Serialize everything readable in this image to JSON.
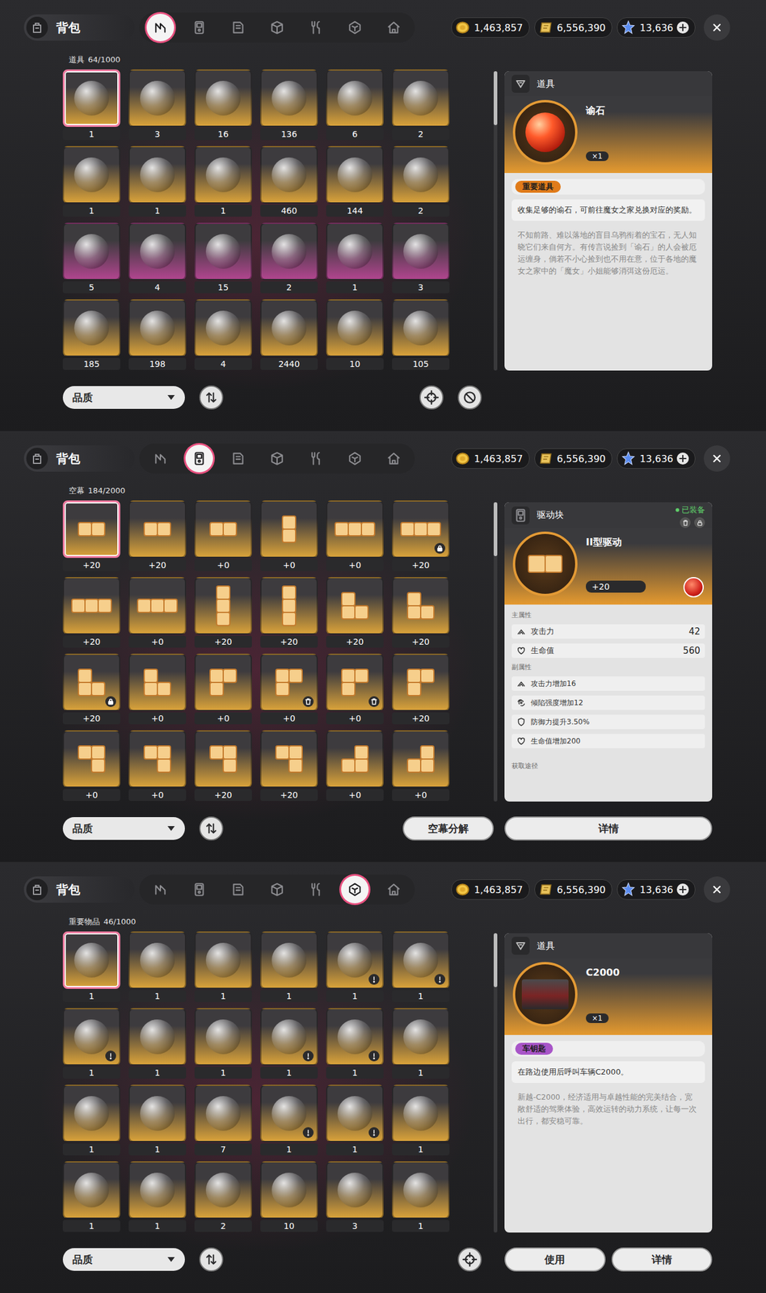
{
  "panels": [
    {
      "title": "背包",
      "tabs": [
        {
          "kind": "items",
          "selected": true
        },
        {
          "kind": "drive",
          "selected": false
        },
        {
          "kind": "book",
          "selected": false
        },
        {
          "kind": "box",
          "selected": false
        },
        {
          "kind": "food",
          "selected": false
        },
        {
          "kind": "important",
          "selected": false
        },
        {
          "kind": "home",
          "selected": false
        }
      ],
      "currencies": [
        {
          "kind": "coin",
          "amount": "1,463,857",
          "addable": false
        },
        {
          "kind": "ticket",
          "amount": "6,556,390",
          "addable": false
        },
        {
          "kind": "crystal",
          "amount": "13,636",
          "addable": true
        }
      ],
      "grid": {
        "label": "道具",
        "capacity": "64/1000",
        "items": [
          {
            "kind": "item",
            "count": "1",
            "color": "#d9a23a",
            "selected": true,
            "badge": "none"
          },
          {
            "kind": "item",
            "count": "3",
            "color": "#d9a23a",
            "selected": false,
            "badge": "none"
          },
          {
            "kind": "item",
            "count": "16",
            "color": "#d9a23a",
            "selected": false,
            "badge": "none"
          },
          {
            "kind": "item",
            "count": "136",
            "color": "#d9a23a",
            "selected": false,
            "badge": "none"
          },
          {
            "kind": "item",
            "count": "6",
            "color": "#d9a23a",
            "selected": false,
            "badge": "none"
          },
          {
            "kind": "item",
            "count": "2",
            "color": "#d9a23a",
            "selected": false,
            "badge": "none"
          },
          {
            "kind": "item",
            "count": "1",
            "color": "#d9a23a",
            "selected": false,
            "badge": "none"
          },
          {
            "kind": "item",
            "count": "1",
            "color": "#d9a23a",
            "selected": false,
            "badge": "none"
          },
          {
            "kind": "item",
            "count": "1",
            "color": "#d9a23a",
            "selected": false,
            "badge": "none"
          },
          {
            "kind": "item",
            "count": "460",
            "color": "#d9a23a",
            "selected": false,
            "badge": "none"
          },
          {
            "kind": "item",
            "count": "144",
            "color": "#d9a23a",
            "selected": false,
            "badge": "none"
          },
          {
            "kind": "item",
            "count": "2",
            "color": "#d9a23a",
            "selected": false,
            "badge": "none"
          },
          {
            "kind": "item",
            "count": "5",
            "color": "#b0458e",
            "selected": false,
            "badge": "none"
          },
          {
            "kind": "item",
            "count": "4",
            "color": "#b0458e",
            "selected": false,
            "badge": "none"
          },
          {
            "kind": "item",
            "count": "15",
            "color": "#b0458e",
            "selected": false,
            "badge": "none"
          },
          {
            "kind": "item",
            "count": "2",
            "color": "#b0458e",
            "selected": false,
            "badge": "none"
          },
          {
            "kind": "item",
            "count": "1",
            "color": "#b0458e",
            "selected": false,
            "badge": "none"
          },
          {
            "kind": "item",
            "count": "3",
            "color": "#b0458e",
            "selected": false,
            "badge": "none"
          },
          {
            "kind": "item",
            "count": "185",
            "color": "#d9a23a",
            "selected": false,
            "badge": "none"
          },
          {
            "kind": "item",
            "count": "198",
            "color": "#d9a23a",
            "selected": false,
            "badge": "none"
          },
          {
            "kind": "item",
            "count": "4",
            "color": "#d9a23a",
            "selected": false,
            "badge": "none"
          },
          {
            "kind": "item",
            "count": "2440",
            "color": "#d9a23a",
            "selected": false,
            "badge": "none"
          },
          {
            "kind": "item",
            "count": "10",
            "color": "#d9a23a",
            "selected": false,
            "badge": "none"
          },
          {
            "kind": "item",
            "count": "105",
            "color": "#d9a23a",
            "selected": false,
            "badge": "none"
          }
        ]
      },
      "filter": {
        "label": "品质"
      },
      "tools": [
        "locate",
        "ban"
      ],
      "left_actions": [],
      "detail": {
        "kind": "gem",
        "category": "道具",
        "name": "谕石",
        "qty": "×1",
        "tag": {
          "text": "重要道具",
          "color": "#e07b1a"
        },
        "desc": "收集足够的谕石，可前往魔女之家兑换对应的奖励。",
        "lore": "不知前路、难以落地的盲目乌鸦衔着的宝石，无人知晓它们来自何方。有传言说捡到「谕石」的人会被厄运缠身，倘若不小心捡到也不用在意，位于各地的魔女之家中的「魔女」小姐能够消弭这份厄运。"
      },
      "detail_actions": []
    },
    {
      "title": "背包",
      "tabs": [
        {
          "kind": "items",
          "selected": false
        },
        {
          "kind": "drive",
          "selected": true
        },
        {
          "kind": "book",
          "selected": false
        },
        {
          "kind": "box",
          "selected": false
        },
        {
          "kind": "food",
          "selected": false
        },
        {
          "kind": "important",
          "selected": false
        },
        {
          "kind": "home",
          "selected": false
        }
      ],
      "currencies": [
        {
          "kind": "coin",
          "amount": "1,463,857",
          "addable": false
        },
        {
          "kind": "ticket",
          "amount": "6,556,390",
          "addable": false
        },
        {
          "kind": "crystal",
          "amount": "13,636",
          "addable": true
        }
      ],
      "grid": {
        "label": "空幕",
        "capacity": "184/2000",
        "items": [
          {
            "kind": "h2",
            "count": "+20",
            "color": "#d9a23a",
            "selected": true,
            "badge": "none"
          },
          {
            "kind": "h2",
            "count": "+20",
            "color": "#d9a23a",
            "selected": false,
            "badge": "none"
          },
          {
            "kind": "h2",
            "count": "+0",
            "color": "#d9a23a",
            "selected": false,
            "badge": "none"
          },
          {
            "kind": "v2",
            "count": "+0",
            "color": "#d9a23a",
            "selected": false,
            "badge": "none"
          },
          {
            "kind": "h3",
            "count": "+0",
            "color": "#d9a23a",
            "selected": false,
            "badge": "none"
          },
          {
            "kind": "h3",
            "count": "+20",
            "color": "#d9a23a",
            "selected": false,
            "badge": "lock"
          },
          {
            "kind": "h3",
            "count": "+20",
            "color": "#d9a23a",
            "selected": false,
            "badge": "none"
          },
          {
            "kind": "h3",
            "count": "+0",
            "color": "#d9a23a",
            "selected": false,
            "badge": "none"
          },
          {
            "kind": "v3",
            "count": "+20",
            "color": "#d9a23a",
            "selected": false,
            "badge": "none"
          },
          {
            "kind": "v3",
            "count": "+20",
            "color": "#d9a23a",
            "selected": false,
            "badge": "none"
          },
          {
            "kind": "ell",
            "count": "+20",
            "color": "#d9a23a",
            "selected": false,
            "badge": "none"
          },
          {
            "kind": "ell",
            "count": "+20",
            "color": "#d9a23a",
            "selected": false,
            "badge": "none"
          },
          {
            "kind": "ell",
            "count": "+20",
            "color": "#d9a23a",
            "selected": false,
            "badge": "lock"
          },
          {
            "kind": "ell",
            "count": "+0",
            "color": "#d9a23a",
            "selected": false,
            "badge": "none"
          },
          {
            "kind": "gamma",
            "count": "+0",
            "color": "#d9a23a",
            "selected": false,
            "badge": "none"
          },
          {
            "kind": "gamma",
            "count": "+0",
            "color": "#d9a23a",
            "selected": false,
            "badge": "trash"
          },
          {
            "kind": "gamma",
            "count": "+0",
            "color": "#d9a23a",
            "selected": false,
            "badge": "trash"
          },
          {
            "kind": "gamma",
            "count": "+20",
            "color": "#d9a23a",
            "selected": false,
            "badge": "none"
          },
          {
            "kind": "seven",
            "count": "+0",
            "color": "#d9a23a",
            "selected": false,
            "badge": "none"
          },
          {
            "kind": "seven",
            "count": "+0",
            "color": "#d9a23a",
            "selected": false,
            "badge": "none"
          },
          {
            "kind": "seven",
            "count": "+20",
            "color": "#d9a23a",
            "selected": false,
            "badge": "none"
          },
          {
            "kind": "seven",
            "count": "+20",
            "color": "#d9a23a",
            "selected": false,
            "badge": "none"
          },
          {
            "kind": "jay",
            "count": "+0",
            "color": "#d9a23a",
            "selected": false,
            "badge": "none"
          },
          {
            "kind": "jay",
            "count": "+0",
            "color": "#d9a23a",
            "selected": false,
            "badge": "none"
          }
        ]
      },
      "filter": {
        "label": "品质"
      },
      "tools": [],
      "left_actions": [
        "空幕分解"
      ],
      "detail": {
        "kind": "drive",
        "shape": "h2",
        "category": "驱动块",
        "status": "已装备",
        "name": "II型驱动",
        "grade": "+20",
        "main_label": "主属性",
        "main": [
          {
            "kind": "attack",
            "label": "攻击力",
            "value": "42"
          },
          {
            "kind": "hp",
            "label": "生命值",
            "value": "560"
          }
        ],
        "sub_label": "副属性",
        "sub": [
          {
            "kind": "attack",
            "label": "攻击力增加16"
          },
          {
            "kind": "impact",
            "label": "倾陷强度增加12"
          },
          {
            "kind": "defense",
            "label": "防御力提升3.50%"
          },
          {
            "kind": "hp",
            "label": "生命值增加200"
          }
        ],
        "source_label": "获取途径"
      },
      "detail_actions": [
        "详情"
      ]
    },
    {
      "title": "背包",
      "tabs": [
        {
          "kind": "items",
          "selected": false
        },
        {
          "kind": "drive",
          "selected": false
        },
        {
          "kind": "book",
          "selected": false
        },
        {
          "kind": "box",
          "selected": false
        },
        {
          "kind": "food",
          "selected": false
        },
        {
          "kind": "important",
          "selected": true
        },
        {
          "kind": "home",
          "selected": false
        }
      ],
      "currencies": [
        {
          "kind": "coin",
          "amount": "1,463,857",
          "addable": false
        },
        {
          "kind": "ticket",
          "amount": "6,556,390",
          "addable": false
        },
        {
          "kind": "crystal",
          "amount": "13,636",
          "addable": true
        }
      ],
      "grid": {
        "label": "重要物品",
        "capacity": "46/1000",
        "items": [
          {
            "kind": "item",
            "count": "1",
            "color": "#d9a23a",
            "selected": true,
            "badge": "none"
          },
          {
            "kind": "item",
            "count": "1",
            "color": "#d9a23a",
            "selected": false,
            "badge": "none"
          },
          {
            "kind": "item",
            "count": "1",
            "color": "#d9a23a",
            "selected": false,
            "badge": "none"
          },
          {
            "kind": "item",
            "count": "1",
            "color": "#d9a23a",
            "selected": false,
            "badge": "none"
          },
          {
            "kind": "item",
            "count": "1",
            "color": "#d9a23a",
            "selected": false,
            "badge": "alert"
          },
          {
            "kind": "item",
            "count": "1",
            "color": "#d9a23a",
            "selected": false,
            "badge": "alert"
          },
          {
            "kind": "item",
            "count": "1",
            "color": "#d9a23a",
            "selected": false,
            "badge": "alert"
          },
          {
            "kind": "item",
            "count": "1",
            "color": "#d9a23a",
            "selected": false,
            "badge": "none"
          },
          {
            "kind": "item",
            "count": "1",
            "color": "#d9a23a",
            "selected": false,
            "badge": "none"
          },
          {
            "kind": "item",
            "count": "1",
            "color": "#d9a23a",
            "selected": false,
            "badge": "alert"
          },
          {
            "kind": "item",
            "count": "1",
            "color": "#d9a23a",
            "selected": false,
            "badge": "alert"
          },
          {
            "kind": "item",
            "count": "1",
            "color": "#d9a23a",
            "selected": false,
            "badge": "none"
          },
          {
            "kind": "item",
            "count": "1",
            "color": "#d9a23a",
            "selected": false,
            "badge": "none"
          },
          {
            "kind": "item",
            "count": "1",
            "color": "#d9a23a",
            "selected": false,
            "badge": "none"
          },
          {
            "kind": "item",
            "count": "7",
            "color": "#d9a23a",
            "selected": false,
            "badge": "none"
          },
          {
            "kind": "item",
            "count": "1",
            "color": "#d9a23a",
            "selected": false,
            "badge": "alert"
          },
          {
            "kind": "item",
            "count": "1",
            "color": "#d9a23a",
            "selected": false,
            "badge": "alert"
          },
          {
            "kind": "item",
            "count": "1",
            "color": "#d9a23a",
            "selected": false,
            "badge": "none"
          },
          {
            "kind": "item",
            "count": "1",
            "color": "#d9a23a",
            "selected": false,
            "badge": "none"
          },
          {
            "kind": "item",
            "count": "1",
            "color": "#d9a23a",
            "selected": false,
            "badge": "none"
          },
          {
            "kind": "item",
            "count": "2",
            "color": "#d9a23a",
            "selected": false,
            "badge": "none"
          },
          {
            "kind": "item",
            "count": "10",
            "color": "#d9a23a",
            "selected": false,
            "badge": "none"
          },
          {
            "kind": "item",
            "count": "3",
            "color": "#d9a23a",
            "selected": false,
            "badge": "none"
          },
          {
            "kind": "item",
            "count": "1",
            "color": "#d9a23a",
            "selected": false,
            "badge": "none"
          }
        ]
      },
      "filter": {
        "label": "品质"
      },
      "tools": [
        "locate"
      ],
      "left_actions": [],
      "detail": {
        "kind": "vehicle",
        "category": "道具",
        "name": "C2000",
        "qty": "×1",
        "tag": {
          "text": "车钥匙",
          "color": "#a855c8"
        },
        "desc": "在路边使用后呼叫车辆C2000。",
        "lore": "新越-C2000，经济适用与卓越性能的完美结合，宽敞舒适的驾乘体验，高效运转的动力系统，让每一次出行，都安稳可靠。"
      },
      "detail_actions": [
        "使用",
        "详情"
      ]
    }
  ]
}
